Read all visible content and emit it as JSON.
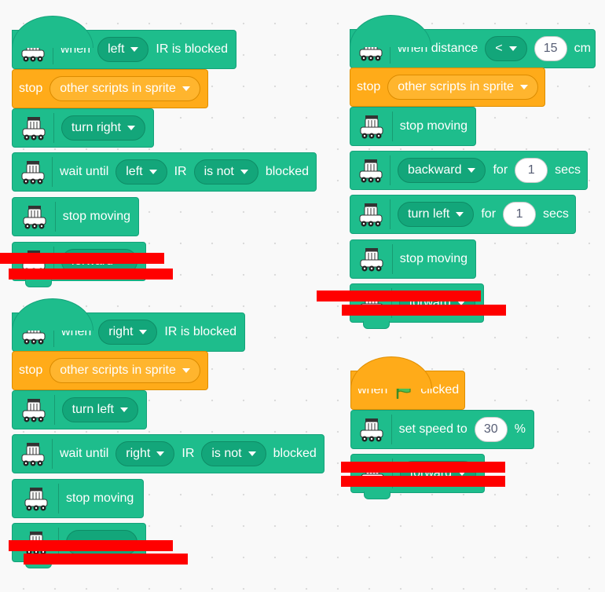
{
  "colors": {
    "motion": "#1ebd8c",
    "control": "#ffab19",
    "redaction": "#ff0000"
  },
  "robot_icon": "robot-car-icon",
  "flag_icon": "green-flag-icon",
  "script1": {
    "hat": {
      "when": "when",
      "side": "left",
      "rest": "IR is blocked"
    },
    "stop": {
      "label": "stop",
      "option": "other scripts in sprite"
    },
    "turn": "turn right",
    "wait": {
      "label": "wait until",
      "side": "left",
      "ir": "IR",
      "cond": "is not",
      "blocked": "blocked"
    },
    "stop_moving": "stop moving",
    "last": "forward"
  },
  "script2": {
    "hat": {
      "when": "when",
      "side": "right",
      "rest": "IR is blocked"
    },
    "stop": {
      "label": "stop",
      "option": "other scripts in sprite"
    },
    "turn": "turn left",
    "wait": {
      "label": "wait until",
      "side": "right",
      "ir": "IR",
      "cond": "is not",
      "blocked": "blocked"
    },
    "stop_moving": "stop moving"
  },
  "script3": {
    "hat": {
      "label": "when distance",
      "op": "<",
      "value": "15",
      "unit": "cm"
    },
    "stop": {
      "label": "stop",
      "option": "other scripts in sprite"
    },
    "stop_moving_1": "stop moving",
    "backward": {
      "dir": "backward",
      "for": "for",
      "value": "1",
      "secs": "secs"
    },
    "turn_left": {
      "dir": "turn left",
      "for": "for",
      "value": "1",
      "secs": "secs"
    },
    "stop_moving_2": "stop moving",
    "last": "forward"
  },
  "script4": {
    "hat": {
      "when": "when",
      "clicked": "clicked"
    },
    "speed": {
      "label": "set speed to",
      "value": "30",
      "unit": "%"
    },
    "last": "forward"
  }
}
